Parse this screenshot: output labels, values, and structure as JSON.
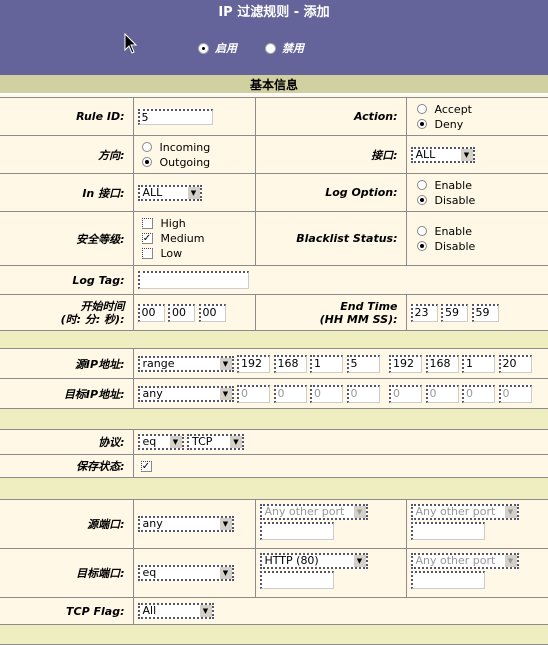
{
  "header": {
    "title": "IP 过滤规则 - 添加",
    "status_options": [
      {
        "label": "启用",
        "checked": true
      },
      {
        "label": "禁用",
        "checked": false
      }
    ]
  },
  "section_title": "基本信息",
  "rule_id": {
    "label": "Rule ID:",
    "value": "5"
  },
  "action": {
    "label": "Action:",
    "options": [
      {
        "label": "Accept",
        "checked": false
      },
      {
        "label": "Deny",
        "checked": true
      }
    ]
  },
  "direction": {
    "label": "方向:",
    "options": [
      {
        "label": "Incoming",
        "checked": false
      },
      {
        "label": "Outgoing",
        "checked": true
      }
    ]
  },
  "interface": {
    "label": "接口:",
    "value": "ALL"
  },
  "in_interface": {
    "label": "In 接口:",
    "value": "ALL"
  },
  "log_option": {
    "label": "Log Option:",
    "options": [
      {
        "label": "Enable",
        "checked": false
      },
      {
        "label": "Disable",
        "checked": true
      }
    ]
  },
  "security_level": {
    "label": "安全等级:",
    "options": [
      {
        "label": "High",
        "checked": false
      },
      {
        "label": "Medium",
        "checked": true
      },
      {
        "label": "Low",
        "checked": false
      }
    ]
  },
  "blacklist_status": {
    "label": "Blacklist Status:",
    "options": [
      {
        "label": "Enable",
        "checked": false
      },
      {
        "label": "Disable",
        "checked": true
      }
    ]
  },
  "log_tag": {
    "label": "Log Tag:",
    "value": ""
  },
  "start_time": {
    "label_line1": "开始时间",
    "label_line2": "(时: 分: 秒):",
    "hh": "00",
    "mm": "00",
    "ss": "00"
  },
  "end_time": {
    "label_line1": "End Time",
    "label_line2": "(HH MM SS):",
    "hh": "23",
    "mm": "59",
    "ss": "59"
  },
  "src_ip": {
    "label": "源IP地址:",
    "mode": "range",
    "start": [
      "192",
      "168",
      "1",
      "5"
    ],
    "end": [
      "192",
      "168",
      "1",
      "20"
    ]
  },
  "dst_ip": {
    "label": "目标IP地址:",
    "mode": "any",
    "start": [
      "0",
      "0",
      "0",
      "0"
    ],
    "end": [
      "0",
      "0",
      "0",
      "0"
    ]
  },
  "protocol": {
    "label": "协议:",
    "operator": "eq",
    "value": "TCP"
  },
  "keep_state": {
    "label": "保存状态:",
    "checked": true
  },
  "src_port": {
    "label": "源端口:",
    "mode": "any",
    "port1": "Any other port",
    "port1_text": "",
    "port2": "Any other port",
    "port2_text": ""
  },
  "dst_port": {
    "label": "目标端口:",
    "mode": "eq",
    "port1": "HTTP (80)",
    "port1_text": "",
    "port2": "Any other port",
    "port2_text": ""
  },
  "tcp_flag": {
    "label": "TCP Flag:",
    "value": "All"
  }
}
